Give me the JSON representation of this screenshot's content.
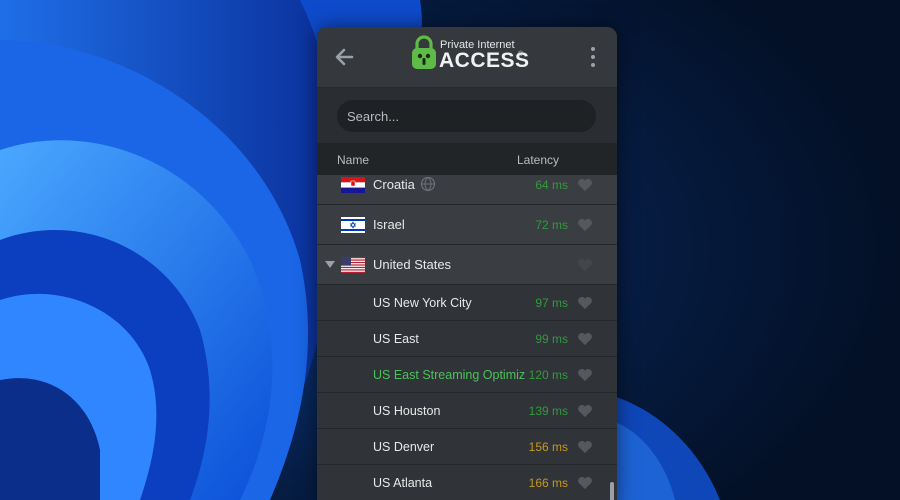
{
  "app": {
    "brand_small": "Private Internet",
    "brand_big": "ACCESS",
    "brand_reg": "®"
  },
  "search": {
    "placeholder": "Search..."
  },
  "columns": {
    "name": "Name",
    "latency": "Latency"
  },
  "rows": [
    {
      "name": "Croatia",
      "latency": "64 ms",
      "type": "country",
      "flag": "croatia-flag-icon",
      "geo": true
    },
    {
      "name": "Israel",
      "latency": "72 ms",
      "type": "country",
      "flag": "israel-flag-icon"
    },
    {
      "name": "United States",
      "latency": "",
      "type": "country",
      "flag": "us-flag-icon",
      "expanded": true
    },
    {
      "name": "US New York City",
      "latency": "97 ms",
      "type": "region"
    },
    {
      "name": "US East",
      "latency": "99 ms",
      "type": "region"
    },
    {
      "name": "US East Streaming Optimiz...",
      "latency": "120 ms",
      "type": "region",
      "highlight": true
    },
    {
      "name": "US Houston",
      "latency": "139 ms",
      "type": "region"
    },
    {
      "name": "US Denver",
      "latency": "156 ms",
      "type": "region",
      "latency_color": "yellow"
    },
    {
      "name": "US Atlanta",
      "latency": "166 ms",
      "type": "region",
      "latency_color": "yellow"
    }
  ],
  "colors": {
    "latency_good": "#2f9c3b",
    "latency_mid": "#c79a1c",
    "highlight": "#4cc15a",
    "brand_green": "#5dbb46"
  }
}
